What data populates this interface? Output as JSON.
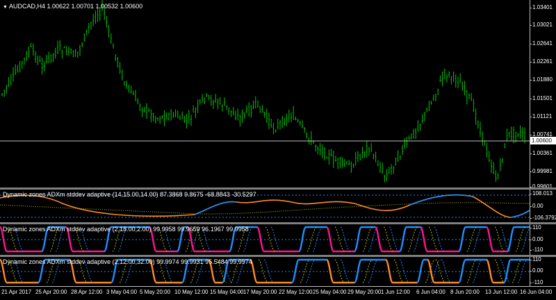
{
  "main": {
    "title_arrow": "▼",
    "title": "AUDCAD,H4  1.00622 1.00701 1.00532 1.00600",
    "price_axis": [
      "1.03401",
      "1.03021",
      "1.02641",
      "1.02261",
      "1.01880",
      "1.01501",
      "1.01121",
      "1.00741",
      "1.00361",
      "0.99981",
      "0.99601"
    ],
    "current_price": "1.00600"
  },
  "panels": [
    {
      "label": "Dynamic zones ADXm stddev adaptive (14,15.00,14.00) 87.3868 9.8675 -68.8843 -30.5297",
      "scale": [
        "108.013",
        "0.00",
        "-106.3792"
      ]
    },
    {
      "label": "Dynamic zones ADXm stddev adaptive (2,18.00,2.00) 99.9958 99.9659 96.1967 99.9958",
      "scale": [
        "110",
        "0.00",
        "-110"
      ]
    },
    {
      "label": "Dynamic zones ADXm stddev adaptive (2,12.00,32.00) 99.9974 99.9931 95.5484 99.9974",
      "scale": [
        "110",
        "0.00",
        "-110"
      ]
    }
  ],
  "time_axis": [
    "21 Apr 2017",
    "25 Apr 20:00",
    "28 Apr 12:00",
    "3 May 04:00",
    "5 May 20:00",
    "10 May 12:00",
    "15 May 04:00",
    "17 May 20:00",
    "22 May 12:00",
    "25 May 04:00",
    "29 May 20:00",
    "1 Jun 12:00",
    "6 Jun 04:00",
    "8 Jun 20:00",
    "13 Jun 12:00",
    "16 Jun 04:00"
  ],
  "colors": {
    "candle": "#00c800",
    "blue": "#1e90ff",
    "orange": "#ff8c28",
    "magenta": "#ff1493",
    "level": "#c0c000"
  }
}
